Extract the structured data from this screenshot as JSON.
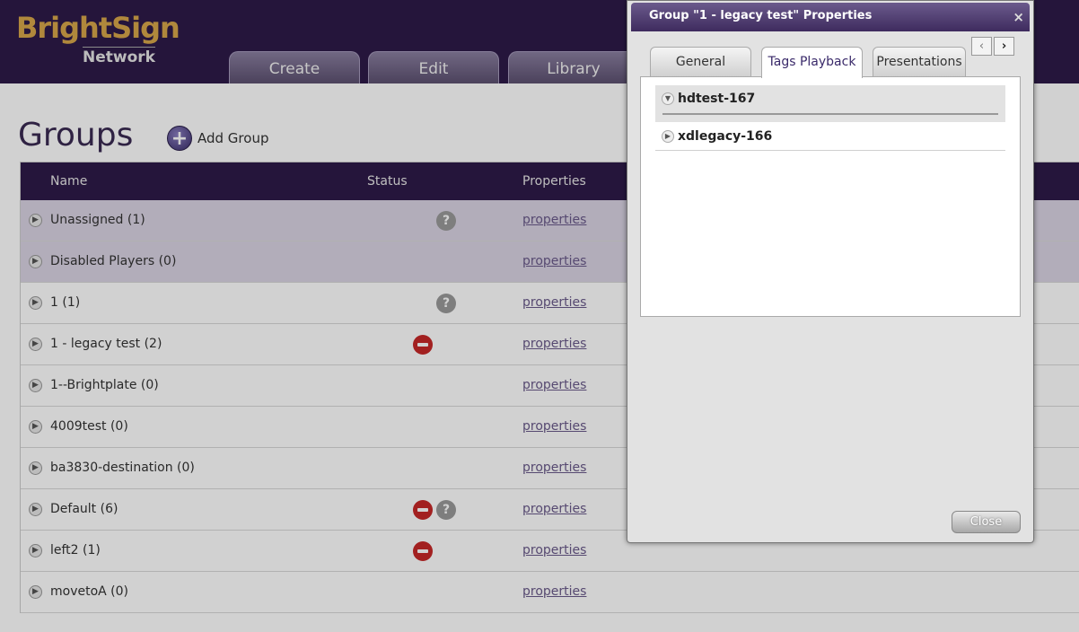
{
  "brand": {
    "name": "BrightSign",
    "sub": "Network",
    "accent": "#d7a64a"
  },
  "nav": [
    {
      "label": "Create"
    },
    {
      "label": "Edit"
    },
    {
      "label": "Library"
    }
  ],
  "page": {
    "title": "Groups",
    "add_group_label": "Add Group"
  },
  "table": {
    "headers": {
      "name": "Name",
      "status": "Status",
      "properties": "Properties"
    },
    "rows": [
      {
        "name": "Unassigned (1)",
        "props": "properties",
        "status": [
          "question"
        ],
        "shaded": true
      },
      {
        "name": "Disabled Players (0)",
        "props": "properties",
        "status": [],
        "shaded": true
      },
      {
        "name": "1 (1)",
        "props": "properties",
        "status": [
          "question"
        ]
      },
      {
        "name": "1 - legacy test (2)",
        "props": "properties",
        "status": [
          "error"
        ]
      },
      {
        "name": "1--Brightplate (0)",
        "props": "properties",
        "status": []
      },
      {
        "name": "4009test (0)",
        "props": "properties",
        "status": []
      },
      {
        "name": "ba3830-destination (0)",
        "props": "properties",
        "status": []
      },
      {
        "name": "Default (6)",
        "props": "properties",
        "status": [
          "error",
          "question"
        ]
      },
      {
        "name": "left2 (1)",
        "props": "properties",
        "status": [
          "error"
        ]
      },
      {
        "name": "movetoA (0)",
        "props": "properties",
        "status": []
      }
    ]
  },
  "dialog": {
    "title": "Group \"1 - legacy test\" Properties",
    "close_glyph": "×",
    "tabs": [
      {
        "label": "General"
      },
      {
        "label": "Tags Playback"
      },
      {
        "label": "Presentations"
      }
    ],
    "active_tab": "Tags Playback",
    "tags": [
      {
        "label": "hdtest-167",
        "expanded": true
      },
      {
        "label": "xdlegacy-166",
        "expanded": false
      }
    ],
    "close_label": "Close"
  }
}
